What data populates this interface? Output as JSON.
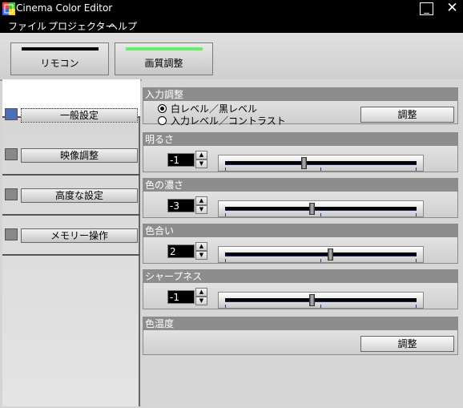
{
  "window": {
    "title": "Cinema Color Editor",
    "minimize": "_",
    "close": "✕"
  },
  "menu": [
    "ファイル",
    "プロジェクター",
    "ヘルプ"
  ],
  "modes": [
    {
      "label": "リモコン",
      "bar_color": "#000000"
    },
    {
      "label": "画質調整",
      "bar_color": "#66ee66"
    }
  ],
  "nav": [
    {
      "label": "一般設定",
      "active": true
    },
    {
      "label": "映像調整",
      "active": false
    },
    {
      "label": "高度な設定",
      "active": false
    },
    {
      "label": "メモリー操作",
      "active": false
    }
  ],
  "input_adjust": {
    "header": "入力調整",
    "options": [
      "白レベル／黒レベル",
      "入力レベル／コントラスト"
    ],
    "selected_index": 0,
    "button": "調整"
  },
  "sliders": [
    {
      "header": "明るさ",
      "value": "-1",
      "level": 0.41
    },
    {
      "header": "色の濃さ",
      "value": "-3",
      "level": 0.45
    },
    {
      "header": "色合い",
      "value": "2",
      "level": 0.55
    },
    {
      "header": "シャープネス",
      "value": "-1",
      "level": 0.45
    }
  ],
  "color_temp": {
    "header": "色温度",
    "button": "調整"
  },
  "colors": {
    "active_indicator": "#4a6fb8",
    "section_header": "#8d8d8d"
  }
}
